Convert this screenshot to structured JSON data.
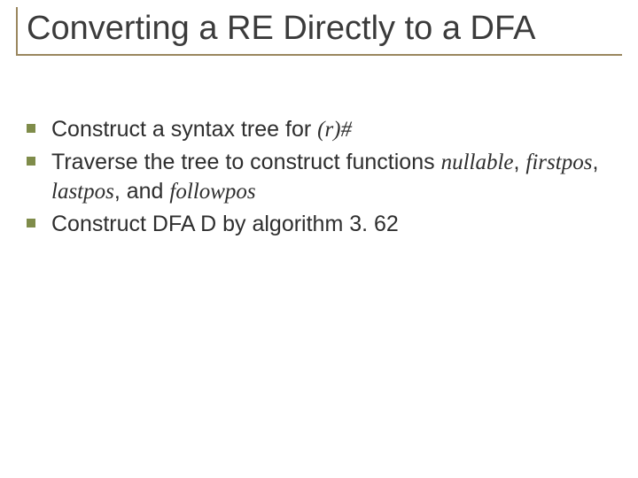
{
  "title": "Converting a RE Directly to a DFA",
  "bullets": [
    {
      "pre": "Construct a syntax tree for ",
      "it1": "(r)#",
      "mid": "",
      "rest": ""
    },
    {
      "pre": "Traverse the tree to construct functions ",
      "it1": "nullable",
      "c1": ", ",
      "it2": "firstpos",
      "c2": ", ",
      "it3": "lastpos",
      "c3": ", and ",
      "it4": "followpos",
      "rest": ""
    },
    {
      "pre": "Construct DFA D by algorithm 3. 62",
      "rest": ""
    }
  ]
}
